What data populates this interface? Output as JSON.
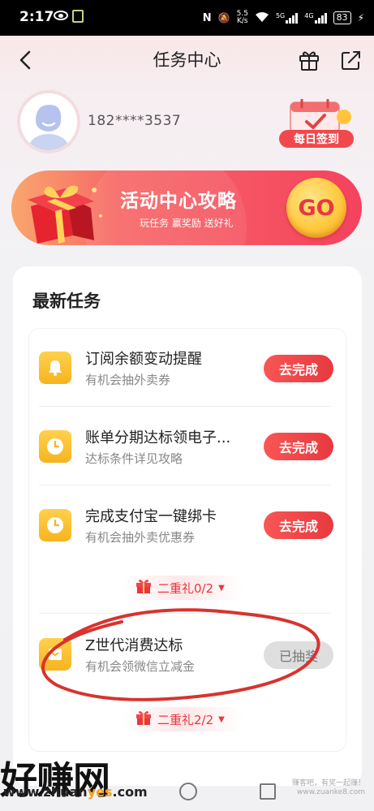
{
  "status_bar": {
    "time": "2:17",
    "net_speed_value": "5.5",
    "net_speed_unit": "K/s",
    "signal_label_1": "5G",
    "signal_label_2": "4G",
    "battery": "83"
  },
  "nav": {
    "title": "任务中心",
    "back_icon": "chevron-left-icon",
    "gift_icon": "gift-icon",
    "share_icon": "share-icon"
  },
  "profile": {
    "phone": "182****3537",
    "checkin_label": "每日签到"
  },
  "banner": {
    "title": "活动中心攻略",
    "subtitle": "玩任务 赢奖励 送好礼",
    "go_label": "GO"
  },
  "tasks_section": {
    "title": "最新任务",
    "tasks": [
      {
        "name": "订阅余额变动提醒",
        "desc": "有机会抽外卖券",
        "button": "去完成",
        "icon": "bell-icon"
      },
      {
        "name": "账单分期达标领电子...",
        "desc": "达标条件详见攻略",
        "button": "去完成",
        "icon": "clock-icon"
      },
      {
        "name": "完成支付宝一键绑卡",
        "desc": "有机会抽外卖优惠券",
        "button": "去完成",
        "icon": "clock-icon"
      },
      {
        "name": "Z世代消费达标",
        "desc": "有机会领微信立减金",
        "button": "已抽奖",
        "icon": "card-icon"
      }
    ],
    "tier_1": "二重礼0/2",
    "tier_2": "二重礼2/2"
  },
  "watermark": {
    "brand": "好赚网",
    "url_pre": "www.zhuan",
    "url_hl": "yes",
    "url_post": ".com",
    "side_line_1": "赚客吧，有奖一起赚！",
    "side_line_2": "www.zuanke8.com"
  },
  "colors": {
    "accent_red": "#e8393f",
    "banner_orange": "#f9a66e",
    "task_icon_yellow": "#f6b41e",
    "annotation_red": "#d8332f"
  }
}
